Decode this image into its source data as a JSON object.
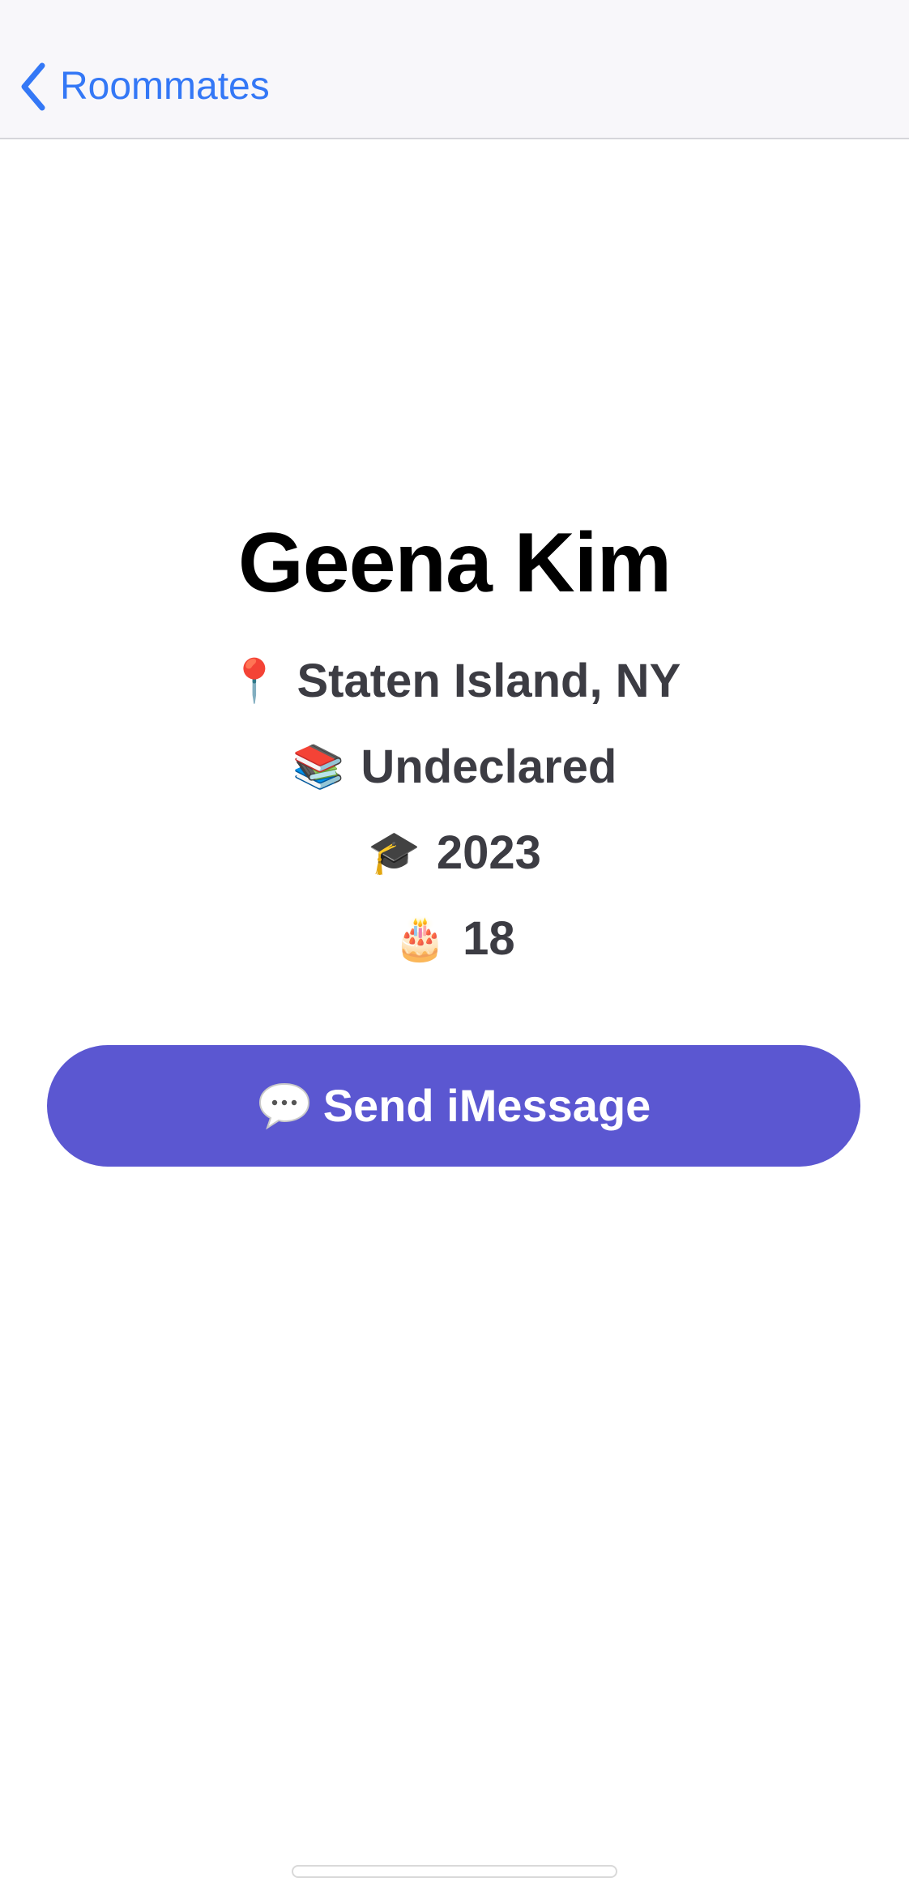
{
  "nav": {
    "back_label": "Roommates",
    "back_icon": "chevron-left-icon",
    "accent_color": "#3478f6"
  },
  "profile": {
    "name": "Geena Kim",
    "details": [
      {
        "icon": "pushpin-icon",
        "glyph": "📍",
        "text": "Staten Island, NY"
      },
      {
        "icon": "books-icon",
        "glyph": "📚",
        "text": "Undeclared"
      },
      {
        "icon": "graduation-cap-icon",
        "glyph": "🎓",
        "text": "2023"
      },
      {
        "icon": "birthday-cake-icon",
        "glyph": "🎂",
        "text": "18"
      }
    ]
  },
  "action": {
    "send_label": "Send iMessage",
    "send_icon": "speech-bubble-icon",
    "button_color": "#5b57d1"
  }
}
